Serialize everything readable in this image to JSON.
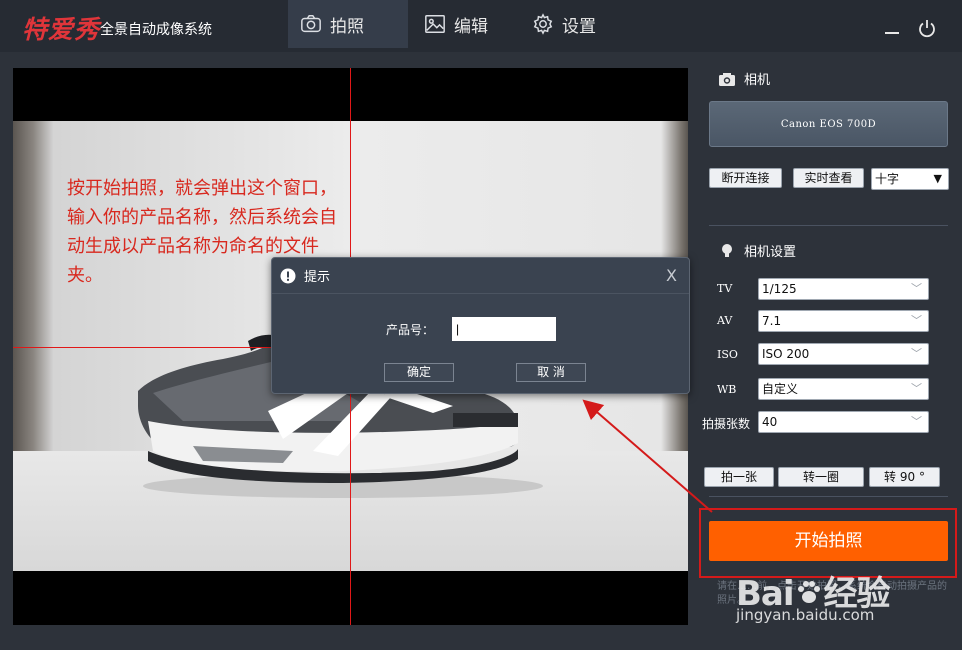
{
  "app": {
    "logo_text": "特爱秀",
    "title": "全景自动成像系统"
  },
  "tabs": [
    {
      "label": "拍照",
      "icon": "camera-icon",
      "active": true
    },
    {
      "label": "编辑",
      "icon": "image-icon",
      "active": false
    },
    {
      "label": "设置",
      "icon": "gear-icon",
      "active": false
    }
  ],
  "window_controls": {
    "minimize_icon": "minimize-icon",
    "power_icon": "power-icon"
  },
  "annotation": {
    "text": "按开始拍照，就会弹出这个窗口，输入你的产品名称，然后系统会自动生成以产品名称为命名的文件夹。",
    "color": "#d8281e"
  },
  "dialog": {
    "title": "提示",
    "close": "X",
    "field_label": "产品号：",
    "field_value": "|",
    "ok_label": "确定",
    "cancel_label": "取 消"
  },
  "panel": {
    "camera_section_title": "相机",
    "camera_model": "Canon EOS 700D",
    "disconnect_label": "断开连接",
    "live_view_label": "实时查看",
    "overlay_select": "十字",
    "settings_section_title": "相机设置",
    "settings": [
      {
        "label": "TV",
        "value": "1/125"
      },
      {
        "label": "AV",
        "value": "7.1"
      },
      {
        "label": "ISO",
        "value": "ISO 200"
      },
      {
        "label": "WB",
        "value": "自定义"
      },
      {
        "label": "拍摄张数",
        "value": "40"
      }
    ],
    "shoot_one_label": "拍一张",
    "rotate_circle_label": "转一圈",
    "rotate_90_label": "转 90 °",
    "start_label": "开始拍照",
    "hint_text": "请在……前，点击开始拍照，系统会自动拍摄产品的照片。"
  },
  "colors": {
    "accent": "#ff6000",
    "brand_red": "#e0353a",
    "background": "#2d323a"
  },
  "watermark": {
    "main_prefix": "Bai",
    "main_suffix": "经验",
    "url": "jingyan.baidu.com"
  }
}
